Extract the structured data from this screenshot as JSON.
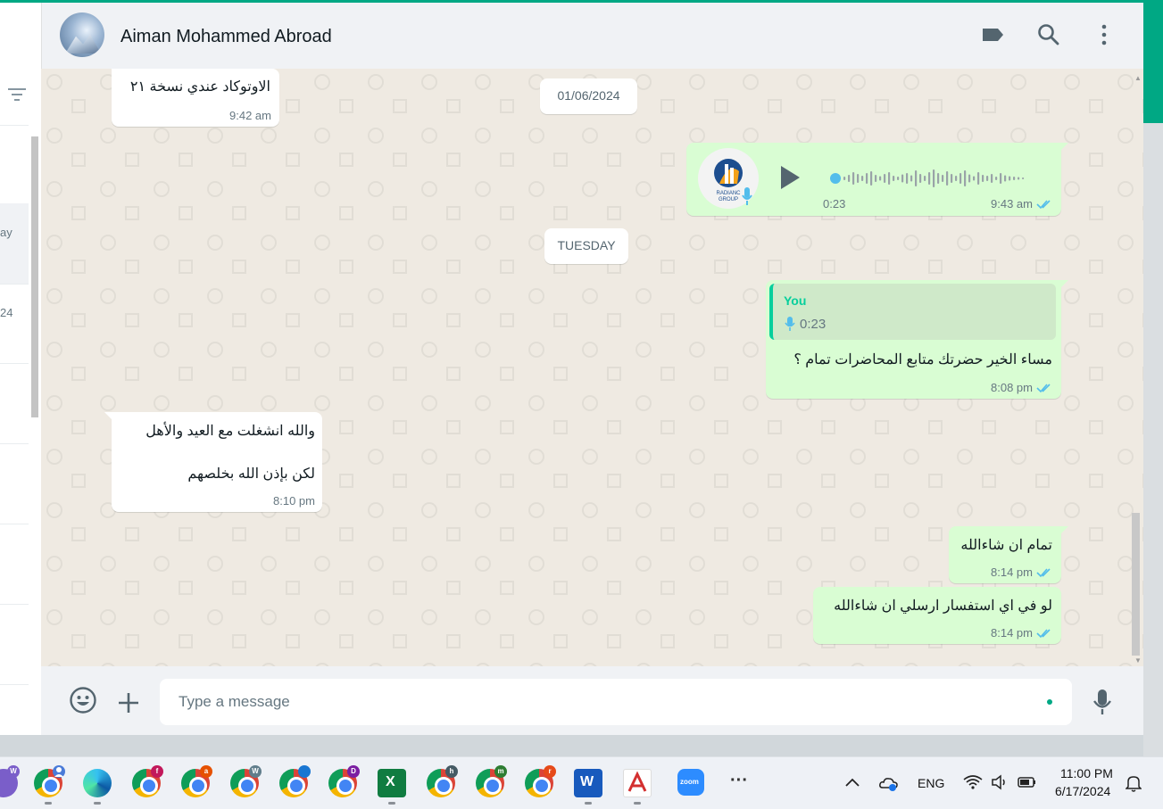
{
  "left_panel": {
    "partial_texts": [
      "ay",
      "24"
    ]
  },
  "header": {
    "contact_name": "Aiman Mohammed Abroad",
    "icons": [
      "label-icon",
      "search-icon",
      "menu-icon"
    ]
  },
  "messages": [
    {
      "dir": "in",
      "text": "الاوتوكاد عندي نسخة ٢١",
      "time": "9:42 am"
    },
    {
      "type": "date",
      "text": "01/06/2024"
    },
    {
      "dir": "out",
      "type": "voice",
      "duration": "0:23",
      "time": "9:43 am",
      "avatar_text": "RADIANC GROUP"
    },
    {
      "type": "date",
      "text": "TUESDAY"
    },
    {
      "dir": "out",
      "quote_author": "You",
      "quote_duration": "0:23",
      "text": "مساء الخير حضرتك متابع المحاضرات تمام ؟",
      "time": "8:08 pm"
    },
    {
      "dir": "in",
      "line1": "والله انشغلت مع العيد والأهل",
      "line2": "لكن بإذن الله بخلصهم",
      "time": "8:10 pm"
    },
    {
      "dir": "out",
      "text": "تمام ان شاءالله",
      "time": "8:14 pm"
    },
    {
      "dir": "out",
      "text": "لو في اي استفسار ارسلي ان شاءالله",
      "time": "8:14 pm"
    }
  ],
  "footer": {
    "placeholder": "Type a message",
    "icons": [
      "emoji-icon",
      "attach-icon",
      "mic-icon"
    ]
  },
  "taskbar": {
    "language": "ENG",
    "time": "11:00 PM",
    "date": "6/17/2024",
    "more_label": "···",
    "zoom_label": "zoom",
    "badges": [
      "W",
      "f",
      "a",
      "W",
      "",
      "D",
      "h",
      "m",
      "r"
    ]
  },
  "colors": {
    "accent": "#00a884",
    "outgoing_bubble": "#d9fdd3",
    "incoming_bubble": "#ffffff",
    "chat_background": "#efeae2",
    "read_ticks": "#53bdeb"
  }
}
